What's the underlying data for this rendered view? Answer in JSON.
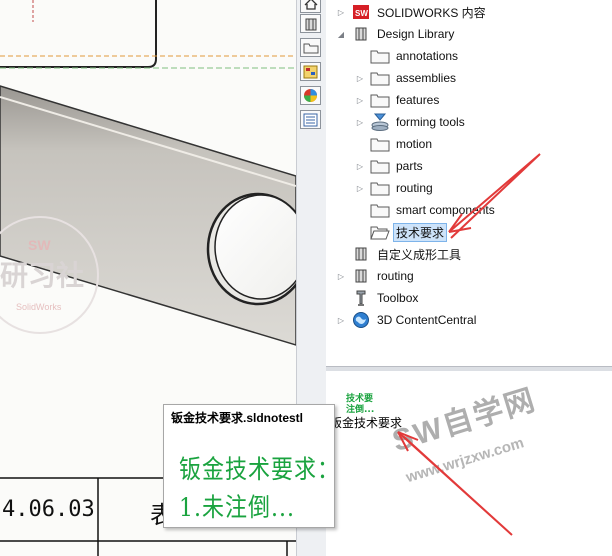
{
  "tree": {
    "items": [
      {
        "label": "SOLIDWORKS 内容",
        "icon": "solidworks-content-icon",
        "expander": "collapsed"
      },
      {
        "label": "Design Library",
        "icon": "design-library-icon",
        "expander": "expanded"
      },
      {
        "label": "annotations",
        "icon": "folder-icon",
        "expander": "none"
      },
      {
        "label": "assemblies",
        "icon": "folder-icon",
        "expander": "collapsed"
      },
      {
        "label": "features",
        "icon": "folder-icon",
        "expander": "collapsed"
      },
      {
        "label": "forming tools",
        "icon": "forming-tools-icon",
        "expander": "collapsed"
      },
      {
        "label": "motion",
        "icon": "folder-icon",
        "expander": "none"
      },
      {
        "label": "parts",
        "icon": "folder-icon",
        "expander": "collapsed"
      },
      {
        "label": "routing",
        "icon": "folder-icon",
        "expander": "collapsed"
      },
      {
        "label": "smart components",
        "icon": "folder-icon",
        "expander": "none"
      },
      {
        "label": "技术要求",
        "icon": "folder-open-icon",
        "expander": "none",
        "selected": true
      },
      {
        "label": "自定义成形工具",
        "icon": "library-icon",
        "expander": "none"
      },
      {
        "label": "routing",
        "icon": "library-icon",
        "expander": "collapsed"
      },
      {
        "label": "Toolbox",
        "icon": "toolbox-icon",
        "expander": "none"
      },
      {
        "label": "3D ContentCentral",
        "icon": "globe-icon",
        "expander": "collapsed"
      }
    ]
  },
  "preview": {
    "item_label": "钣金技术要求",
    "thumb_lines": [
      "技术要",
      "注倒..."
    ]
  },
  "tooltip": {
    "title": "钣金技术要求.sldnotestl",
    "lines": [
      "钣金技术要求：",
      "1.未注倒..."
    ]
  },
  "drawing": {
    "date_text": "4.06.03",
    "cell_char": "表",
    "watermark_left": [
      "SW",
      "研习社",
      "SolidWorks"
    ]
  },
  "watermark": {
    "main": "SW自学网",
    "url": "www.wrjzxw.com"
  },
  "colors": {
    "selection": "#cde3fa",
    "annotation_arrow": "#e23a3a",
    "note_green": "#1aa33f"
  }
}
